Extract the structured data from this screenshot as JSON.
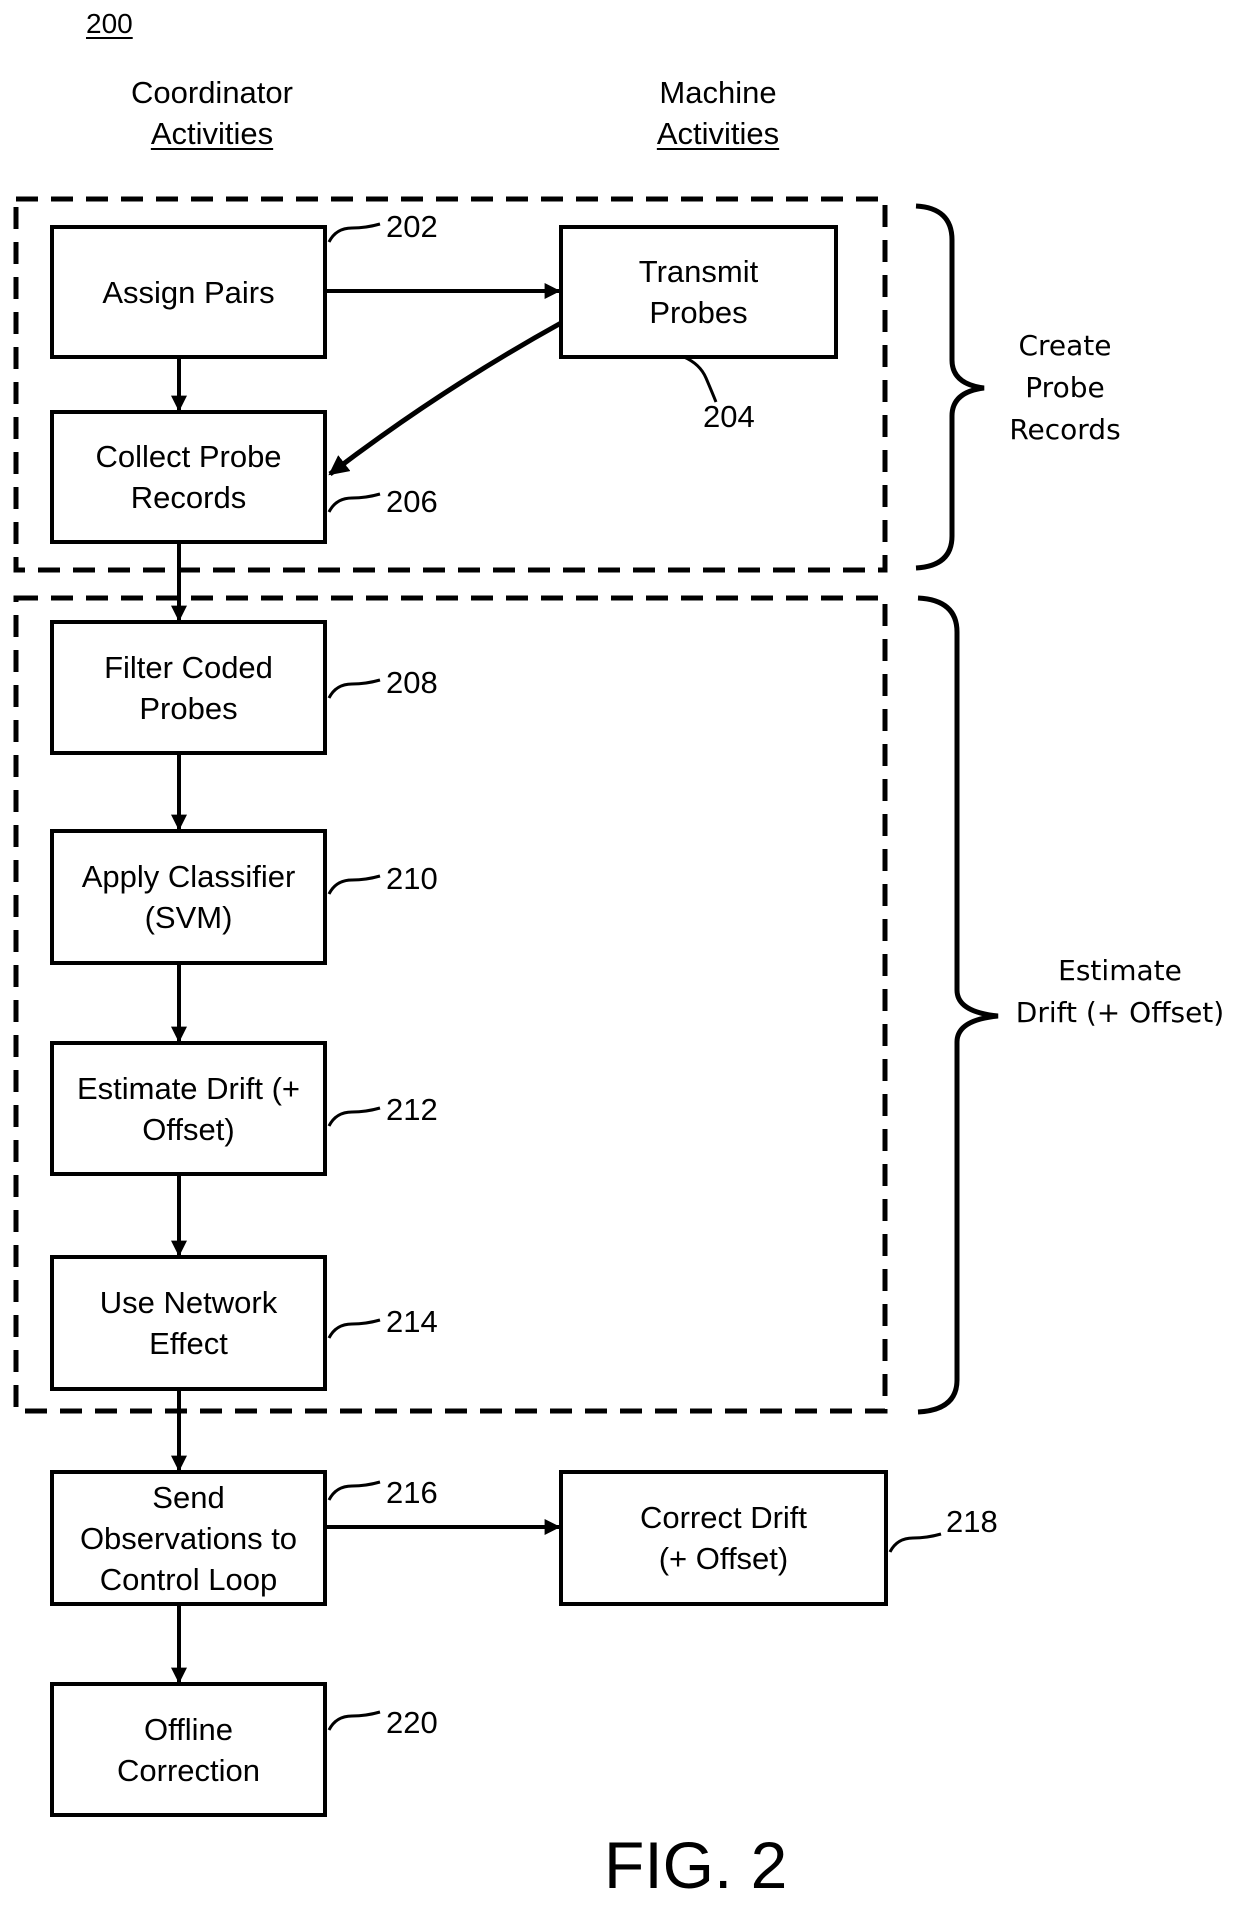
{
  "figure": {
    "reference_number": "200",
    "caption": "FIG. 2"
  },
  "columns": {
    "coordinator": {
      "line1": "Coordinator",
      "line2": "Activities"
    },
    "machine": {
      "line1": "Machine",
      "line2": "Activities"
    }
  },
  "groups": {
    "create_probe_records": {
      "label": "Create\nProbe\nRecords"
    },
    "estimate_drift": {
      "label": "Estimate\nDrift (+ Offset)"
    }
  },
  "steps": {
    "assign_pairs": {
      "label": "Assign Pairs",
      "ref": "202"
    },
    "transmit_probes": {
      "label": "Transmit\nProbes",
      "ref": "204"
    },
    "collect_probe_records": {
      "label": "Collect Probe\nRecords",
      "ref": "206"
    },
    "filter_coded_probes": {
      "label": "Filter Coded\nProbes",
      "ref": "208"
    },
    "apply_classifier": {
      "label": "Apply Classifier\n(SVM)",
      "ref": "210"
    },
    "estimate_drift": {
      "label": "Estimate Drift (+\nOffset)",
      "ref": "212"
    },
    "use_network_effect": {
      "label": "Use Network\nEffect",
      "ref": "214"
    },
    "send_observations": {
      "label": "Send\nObservations to\nControl Loop",
      "ref": "216"
    },
    "correct_drift": {
      "label": "Correct Drift\n(+ Offset)",
      "ref": "218"
    },
    "offline_correction": {
      "label": "Offline\nCorrection",
      "ref": "220"
    }
  }
}
